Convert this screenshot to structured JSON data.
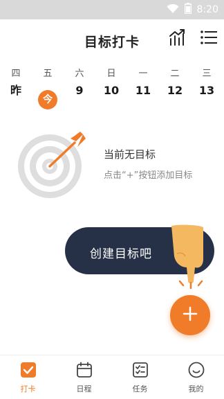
{
  "status_bar": {
    "time": "8:20"
  },
  "header": {
    "title": "目标打卡"
  },
  "week": {
    "days": [
      {
        "weekday": "四",
        "date": "昨",
        "today": false
      },
      {
        "weekday": "五",
        "date": "今",
        "today": true
      },
      {
        "weekday": "六",
        "date": "9",
        "today": false
      },
      {
        "weekday": "日",
        "date": "10",
        "today": false
      },
      {
        "weekday": "一",
        "date": "11",
        "today": false
      },
      {
        "weekday": "二",
        "date": "12",
        "today": false
      },
      {
        "weekday": "三",
        "date": "13",
        "today": false
      }
    ]
  },
  "empty_state": {
    "title": "当前无目标",
    "hint": "点击“+”按钮添加目标"
  },
  "tooltip": {
    "text": "创建目标吧"
  },
  "fab": {
    "icon": "plus-icon"
  },
  "bottom_nav": {
    "items": [
      {
        "label": "打卡",
        "icon": "checkin-icon",
        "active": true
      },
      {
        "label": "日程",
        "icon": "calendar-icon",
        "active": false
      },
      {
        "label": "任务",
        "icon": "task-list-icon",
        "active": false
      },
      {
        "label": "我的",
        "icon": "profile-icon",
        "active": false
      }
    ]
  },
  "colors": {
    "accent": "#f07c2a",
    "tooltip_bg": "#263147",
    "status_bar_bg": "#d9d9d9"
  }
}
